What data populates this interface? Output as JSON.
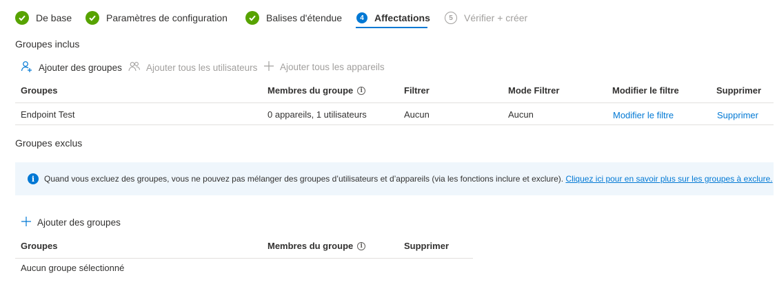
{
  "wizard": {
    "steps": [
      {
        "label": "De base",
        "state": "done"
      },
      {
        "label": "Paramètres de configuration",
        "state": "done"
      },
      {
        "label": "Balises d'étendue",
        "state": "done"
      },
      {
        "label": "Affectations",
        "number": "4",
        "state": "active"
      },
      {
        "label": "Vérifier + créer",
        "number": "5",
        "state": "disabled"
      }
    ]
  },
  "included": {
    "title": "Groupes inclus",
    "actions": {
      "add_groups": "Ajouter des groupes",
      "add_all_users": "Ajouter tous les utilisateurs",
      "add_all_devices": "Ajouter tous les appareils"
    },
    "columns": {
      "groups": "Groupes",
      "members": "Membres du groupe",
      "filter": "Filtrer",
      "filter_mode": "Mode Filtrer",
      "edit_filter": "Modifier le filtre",
      "delete": "Supprimer"
    },
    "rows": [
      {
        "group": "Endpoint Test",
        "members": "0 appareils, 1 utilisateurs",
        "filter": "Aucun",
        "filter_mode": "Aucun",
        "edit_filter": "Modifier le filtre",
        "delete": "Supprimer"
      }
    ]
  },
  "excluded": {
    "title": "Groupes exclus",
    "banner": {
      "text": "Quand vous excluez des groupes, vous ne pouvez pas mélanger des groupes d’utilisateurs et d’appareils (via les fonctions inclure et exclure).",
      "link": "Cliquez ici pour en savoir plus sur les groupes à exclure."
    },
    "actions": {
      "add_groups": "Ajouter des groupes"
    },
    "columns": {
      "groups": "Groupes",
      "members": "Membres du groupe",
      "delete": "Supprimer"
    },
    "empty_text": "Aucun groupe sélectionné"
  },
  "colors": {
    "accent": "#0078d4",
    "success": "#57a300",
    "disabled": "#a19f9d",
    "banner_bg": "#eff6fc"
  }
}
